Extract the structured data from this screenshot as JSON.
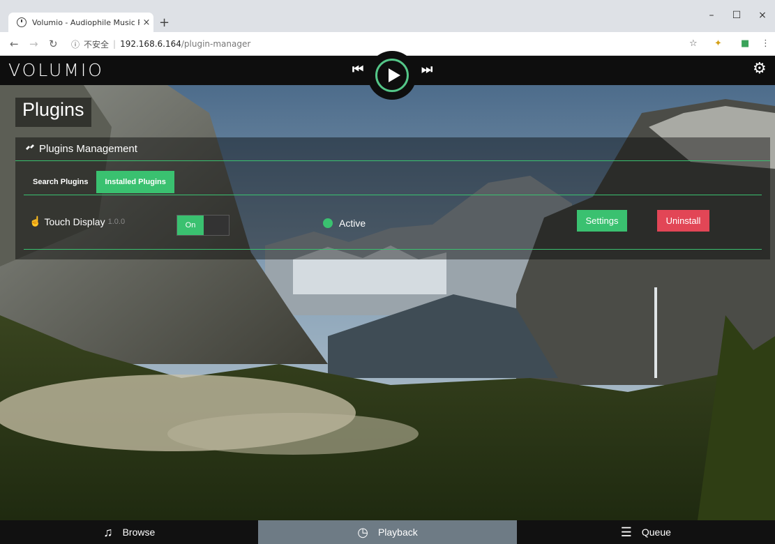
{
  "browser": {
    "tab_title": "Volumio - Audiophile Music Pl",
    "new_tab": "+",
    "url_security": "不安全",
    "url_host": "192.168.6.164",
    "url_path": "/plugin-manager"
  },
  "header": {
    "logo": "VOLUMIO"
  },
  "page": {
    "title": "Plugins",
    "panel_title": "Plugins Management",
    "tabs": [
      {
        "label": "Search Plugins"
      },
      {
        "label": "Installed Plugins"
      }
    ],
    "plugin": {
      "name": "Touch Display",
      "version": "1.0.0",
      "toggle_label": "On",
      "status": "Active",
      "settings_label": "Settings",
      "uninstall_label": "Uninstall"
    }
  },
  "bottom_nav": [
    {
      "label": "Browse",
      "icon": "music-note-icon"
    },
    {
      "label": "Playback",
      "icon": "clock-icon"
    },
    {
      "label": "Queue",
      "icon": "list-icon"
    }
  ],
  "colors": {
    "accent": "#3ac170",
    "danger": "#e24656",
    "active_nav": "#6e7b85"
  }
}
